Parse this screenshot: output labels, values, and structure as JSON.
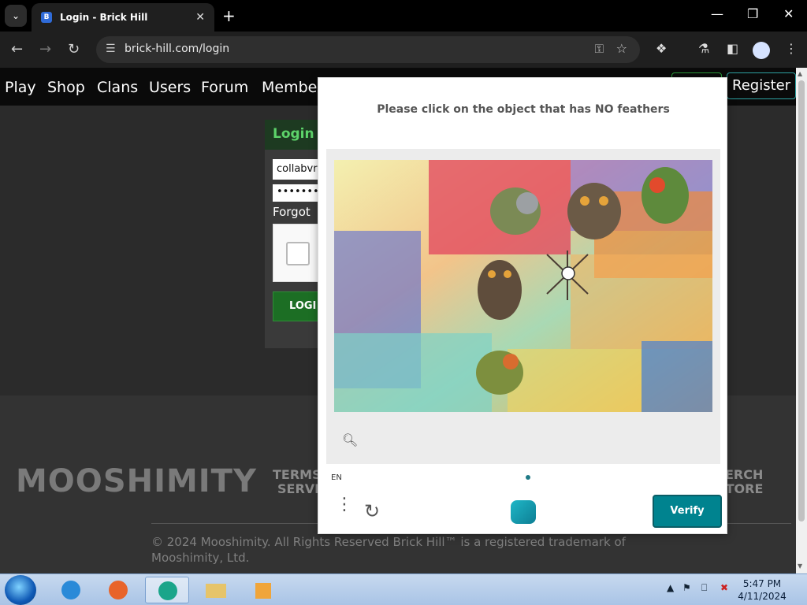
{
  "browser": {
    "tab_title": "Login - Brick Hill",
    "url": "brick-hill.com/login"
  },
  "site": {
    "nav": [
      "Play",
      "Shop",
      "Clans",
      "Users",
      "Forum",
      "Membe"
    ],
    "register": "Register"
  },
  "login_card": {
    "title": "Login",
    "username_value": "collabvr",
    "password_value": "•••••••••",
    "forgot_text": "Forgot",
    "login_button": "LOGI"
  },
  "captcha": {
    "prompt": "Please click on the object that has NO feathers",
    "lang": "EN",
    "verify": "Verify"
  },
  "footer": {
    "logo": "MOOSHIMITY",
    "terms": [
      "TERMS",
      "SERVI"
    ],
    "merch": [
      "ERCH",
      "TORE"
    ],
    "copyright": "© 2024 Mooshimity. All Rights Reserved Brick Hill™ is a registered trademark of Mooshimity, Ltd."
  },
  "taskbar": {
    "time": "5:47 PM",
    "date": "4/11/2024"
  }
}
